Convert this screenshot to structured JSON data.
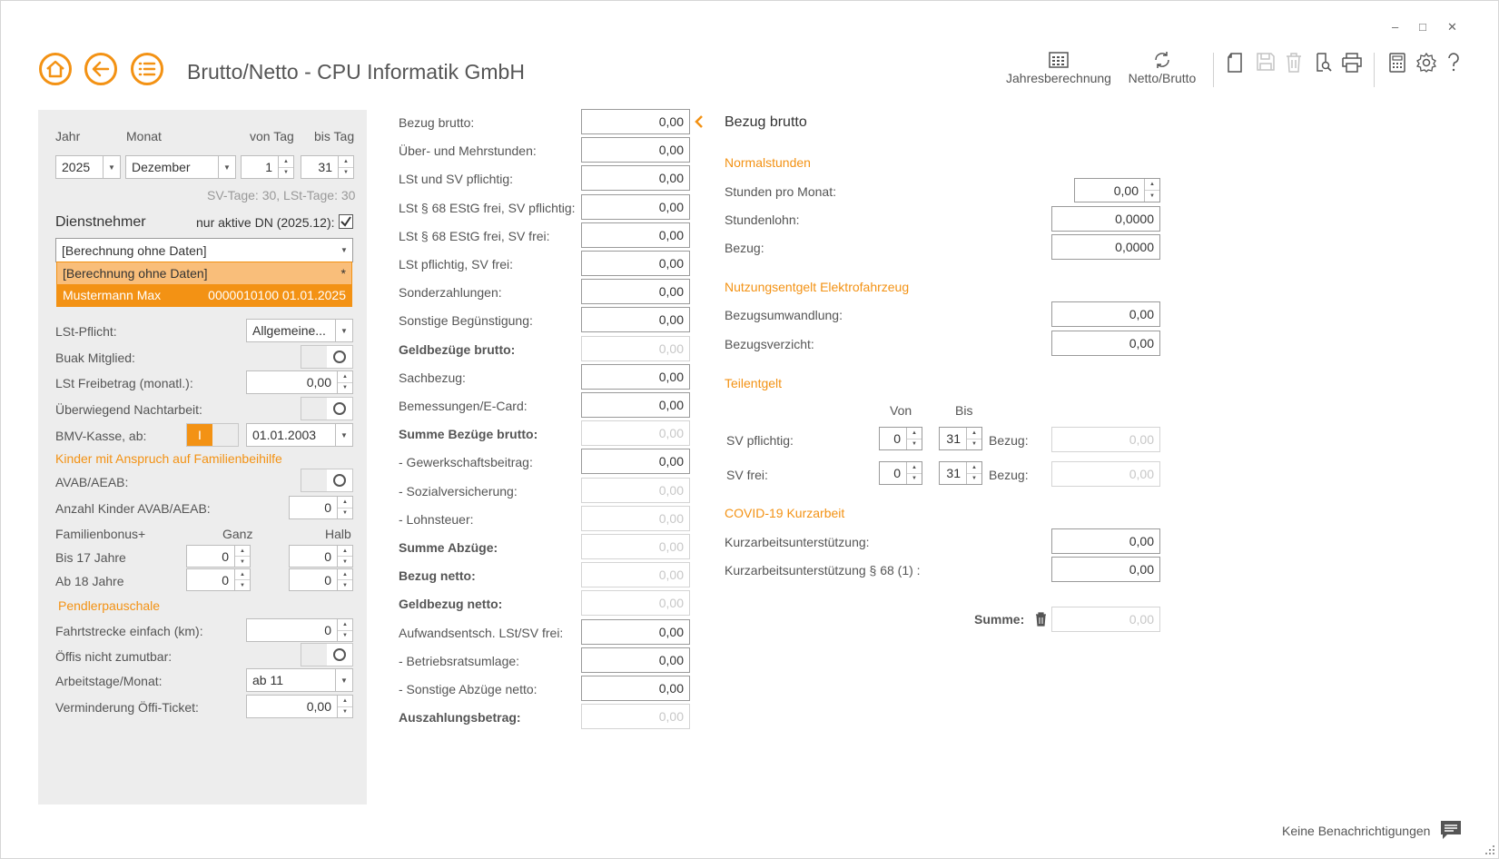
{
  "window": {
    "minimize": "–",
    "maximize": "□",
    "close": "✕"
  },
  "header": {
    "title": "Brutto/Netto - CPU Informatik GmbH"
  },
  "toolbar": {
    "jahresberechnung": "Jahresberechnung",
    "netto_brutto": "Netto/Brutto"
  },
  "left": {
    "jahr_label": "Jahr",
    "monat_label": "Monat",
    "von_tag_label": "von Tag",
    "bis_tag_label": "bis Tag",
    "jahr": "2025",
    "monat": "Dezember",
    "von_tag": "1",
    "bis_tag": "31",
    "sv_tage": "SV-Tage: 30,  LSt-Tage: 30",
    "dienstnehmer": "Dienstnehmer",
    "nur_aktive": "nur aktive DN (2025.12):",
    "dn_select": "[Berechnung ohne Daten]",
    "dropdown": [
      {
        "name": "[Berechnung ohne Daten]",
        "extra": "*"
      },
      {
        "name": "Mustermann Max",
        "extra": "0000010100  01.01.2025"
      }
    ],
    "lst_pflicht_label": "LSt-Pflicht:",
    "lst_pflicht": "Allgemeine...",
    "buak_label": "Buak Mitglied:",
    "freibetrag_label": "LSt Freibetrag (monatl.):",
    "freibetrag": "0,00",
    "nachtarbeit_label": "Überwiegend Nachtarbeit:",
    "bmv_label": "BMV-Kasse, ab:",
    "bmv_toggle": "I",
    "bmv_date": "01.01.2003",
    "kinder_header": "Kinder mit Anspruch auf Familienbeihilfe",
    "avab_label": "AVAB/AEAB:",
    "anzahl_kinder_label": "Anzahl Kinder AVAB/AEAB:",
    "anzahl_kinder": "0",
    "familienbonus_label": "Familienbonus+",
    "ganz_label": "Ganz",
    "halb_label": "Halb",
    "bis17_label": "Bis 17 Jahre",
    "bis17_ganz": "0",
    "bis17_halb": "0",
    "ab18_label": "Ab 18 Jahre",
    "ab18_ganz": "0",
    "ab18_halb": "0",
    "pendler_header": "Pendlerpauschale",
    "fahrtstrecke_label": "Fahrtstrecke einfach (km):",
    "fahrtstrecke": "0",
    "oeffis_label": "Öffis nicht zumutbar:",
    "arbeitstage_label": "Arbeitstage/Monat:",
    "arbeitstage": "ab 11",
    "verminderung_label": "Verminderung Öffi-Ticket:",
    "verminderung": "0,00"
  },
  "middle": {
    "rows": [
      {
        "label": "Bezug brutto:",
        "value": "0,00",
        "bold": false,
        "disabled": false
      },
      {
        "label": "Über- und Mehrstunden:",
        "value": "0,00",
        "bold": false,
        "disabled": false
      },
      {
        "label": "LSt und SV pflichtig:",
        "value": "0,00",
        "bold": false,
        "disabled": false
      },
      {
        "label": "LSt § 68 EStG frei, SV pflichtig:",
        "value": "0,00",
        "bold": false,
        "disabled": false
      },
      {
        "label": "LSt § 68 EStG frei, SV frei:",
        "value": "0,00",
        "bold": false,
        "disabled": false
      },
      {
        "label": "LSt pflichtig, SV frei:",
        "value": "0,00",
        "bold": false,
        "disabled": false
      },
      {
        "label": "Sonderzahlungen:",
        "value": "0,00",
        "bold": false,
        "disabled": false
      },
      {
        "label": "Sonstige Begünstigung:",
        "value": "0,00",
        "bold": false,
        "disabled": false
      },
      {
        "label": "Geldbezüge brutto:",
        "value": "0,00",
        "bold": true,
        "disabled": true
      },
      {
        "label": "Sachbezug:",
        "value": "0,00",
        "bold": false,
        "disabled": false
      },
      {
        "label": "Bemessungen/E-Card:",
        "value": "0,00",
        "bold": false,
        "disabled": false
      },
      {
        "label": "Summe Bezüge brutto:",
        "value": "0,00",
        "bold": true,
        "disabled": true
      },
      {
        "label": "- Gewerkschaftsbeitrag:",
        "value": "0,00",
        "bold": false,
        "disabled": false
      },
      {
        "label": "- Sozialversicherung:",
        "value": "0,00",
        "bold": false,
        "disabled": true
      },
      {
        "label": "- Lohnsteuer:",
        "value": "0,00",
        "bold": false,
        "disabled": true
      },
      {
        "label": "Summe Abzüge:",
        "value": "0,00",
        "bold": true,
        "disabled": true
      },
      {
        "label": "Bezug netto:",
        "value": "0,00",
        "bold": true,
        "disabled": true
      },
      {
        "label": "Geldbezug netto:",
        "value": "0,00",
        "bold": true,
        "disabled": true
      },
      {
        "label": "Aufwandsentsch. LSt/SV frei:",
        "value": "0,00",
        "bold": false,
        "disabled": false
      },
      {
        "label": "- Betriebsratsumlage:",
        "value": "0,00",
        "bold": false,
        "disabled": false
      },
      {
        "label": "- Sonstige Abzüge netto:",
        "value": "0,00",
        "bold": false,
        "disabled": false
      },
      {
        "label": "Auszahlungsbetrag:",
        "value": "0,00",
        "bold": true,
        "disabled": true
      }
    ]
  },
  "right": {
    "title": "Bezug brutto",
    "normalstunden": "Normalstunden",
    "stunden_label": "Stunden pro Monat:",
    "stunden": "0,00",
    "stundenlohn_label": "Stundenlohn:",
    "stundenlohn": "0,0000",
    "bezug_label": "Bezug:",
    "bezug": "0,0000",
    "nutzung_header": "Nutzungsentgelt Elektrofahrzeug",
    "bezugsumwandlung_label": "Bezugsumwandlung:",
    "bezugsumwandlung": "0,00",
    "bezugsverzicht_label": "Bezugsverzicht:",
    "bezugsverzicht": "0,00",
    "teilentgelt_header": "Teilentgelt",
    "von_label": "Von",
    "bis_label": "Bis",
    "sv_pflichtig_label": "SV pflichtig:",
    "sv_pflichtig_von": "0",
    "sv_pflichtig_bis": "31",
    "sv_pflichtig_bezug_label": "Bezug:",
    "sv_pflichtig_bezug": "0,00",
    "sv_frei_label": "SV frei:",
    "sv_frei_von": "0",
    "sv_frei_bis": "31",
    "sv_frei_bezug_label": "Bezug:",
    "sv_frei_bezug": "0,00",
    "covid_header": "COVID-19 Kurzarbeit",
    "kurzarbeit_label": "Kurzarbeitsunterstützung:",
    "kurzarbeit": "0,00",
    "kurzarbeit68_label": "Kurzarbeitsunterstützung § 68 (1) :",
    "kurzarbeit68": "0,00",
    "summe_label": "Summe:",
    "summe": "0,00"
  },
  "footer": {
    "notifications": "Keine Benachrichtigungen"
  },
  "colors": {
    "accent": "#f39214",
    "panel": "#ededed"
  }
}
